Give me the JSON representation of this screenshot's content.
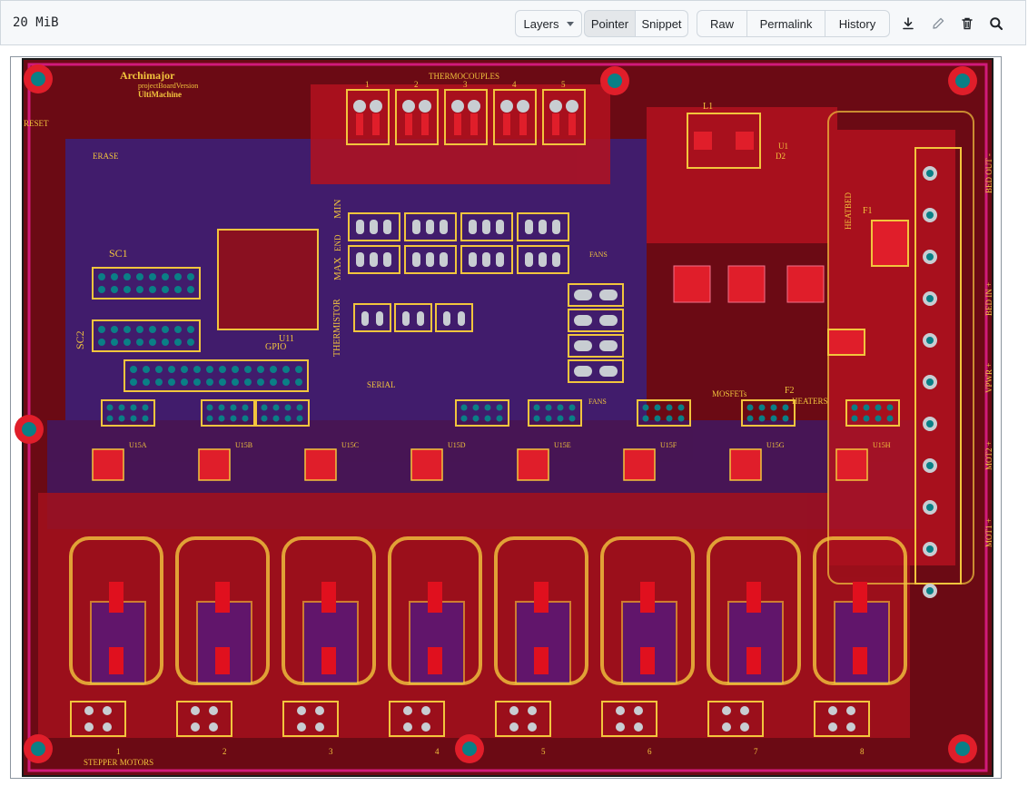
{
  "toolbar": {
    "file_size": "20 MiB",
    "layers_label": "Layers",
    "pointer_label": "Pointer",
    "snippet_label": "Snippet",
    "raw_label": "Raw",
    "permalink_label": "Permalink",
    "history_label": "History",
    "icons": [
      "download-icon",
      "pencil-icon",
      "trash-icon",
      "search-icon"
    ]
  },
  "board": {
    "product": "Archimajor",
    "version_label": "projectBoardVersion",
    "brand": "UltiMachine",
    "silkscreen": {
      "reset": "RESET",
      "erase": "ERASE",
      "sc1": "SC1",
      "sc2": "SC2",
      "gpio": "GPIO",
      "u11": "U11",
      "thermocouples": "THERMOCOUPLES",
      "thermistor": "THERMISTOR",
      "min": "MIN",
      "end": "END",
      "max": "MAX",
      "fans_top": "FANS",
      "fans_bottom": "FANS",
      "serial": "SERIAL",
      "mosfets": "MOSFETs",
      "heaters": "HEATERS",
      "heatbed": "HEATBED",
      "l1": "L1",
      "f1": "F1",
      "f2": "F2",
      "d2": "D2",
      "u1": "U1",
      "bed_out": "BED OUT -",
      "bed_in": "BED IN +",
      "vpwr": "VPWR +",
      "mot2": "MOT2 +",
      "mot1": "MOT1 +",
      "stepper_motors": "STEPPER MOTORS"
    },
    "thermocouple_channels": [
      "1",
      "2",
      "3",
      "4",
      "5"
    ],
    "driver_labels": [
      "U15A",
      "U15B",
      "U15C",
      "U15D",
      "U15E",
      "U15F",
      "U15G",
      "U15H"
    ],
    "stepper_numbers": [
      "1",
      "2",
      "3",
      "4",
      "5",
      "6",
      "7",
      "8"
    ],
    "colors": {
      "substrate": "#6b0a14",
      "copper_top": "#e01e2a",
      "copper_bottom": "#1f2bb5",
      "silkscreen": "#f2c53d",
      "pad": "#c8cdd2",
      "drill": "#0a7f86",
      "outline": "#d11a7a"
    }
  }
}
